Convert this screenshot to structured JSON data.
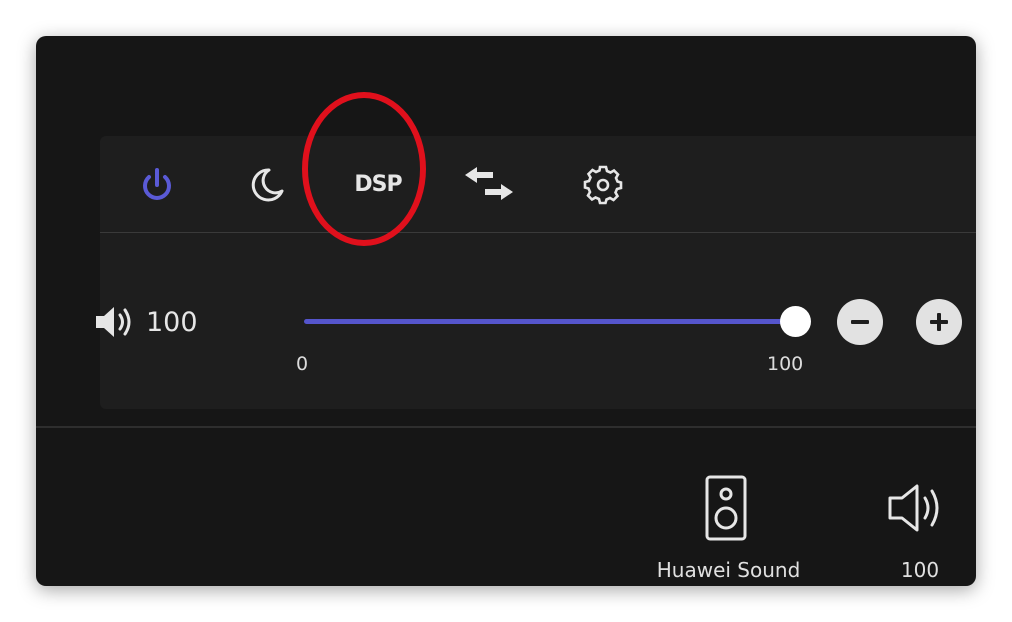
{
  "toolbar": {
    "icons": [
      "power-icon",
      "moon-icon",
      "dsp",
      "swap-arrows-icon",
      "gear-icon"
    ],
    "dsp_label": "DSP",
    "power_color": "#5a5ad6"
  },
  "volume": {
    "icon": "speaker-icon",
    "value": "100",
    "slider_min": "0",
    "slider_max": "100",
    "level_fraction": 1.0,
    "accent_color": "#5555cc"
  },
  "highlight": {
    "color": "#e0101c",
    "target": "dsp"
  },
  "device": {
    "name": "Huawei Sound",
    "volume": "100",
    "icons": [
      "speaker-device-icon",
      "speaker-volume-icon"
    ]
  }
}
